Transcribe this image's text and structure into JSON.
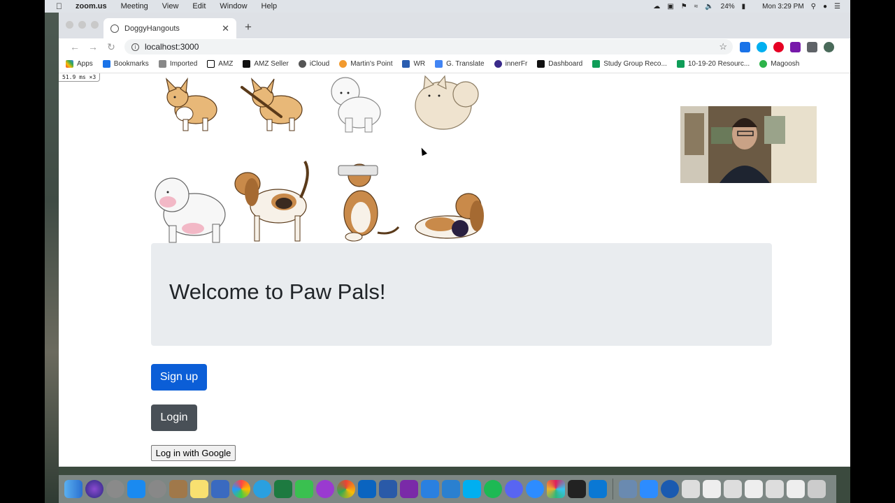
{
  "menubar": {
    "app_name": "zoom.us",
    "items": [
      "Meeting",
      "View",
      "Edit",
      "Window",
      "Help"
    ],
    "battery": "24%",
    "clock": "Mon 3:29 PM"
  },
  "browser": {
    "tab_title": "DoggyHangouts",
    "url": "localhost:3000",
    "bookmarks": [
      "Apps",
      "Bookmarks",
      "Imported",
      "AMZ",
      "AMZ Seller",
      "iCloud",
      "Martin's Point",
      "WR",
      "G. Translate",
      "innerFr",
      "Dashboard",
      "Study Group Reco...",
      "10-19-20 Resourc...",
      "Magoosh"
    ]
  },
  "page": {
    "perf_overlay": "51.9 ms ×3",
    "welcome_title": "Welcome to Paw Pals!",
    "signup_label": "Sign up",
    "login_label": "Login",
    "google_label": "Log in with Google"
  },
  "colors": {
    "primary": "#0b5ed7",
    "secondary": "#495057",
    "jumbotron": "#e9ecef"
  },
  "icons": {
    "dogs": [
      "corgi",
      "corgi-with-stick",
      "bichon",
      "pomeranian",
      "bulldog",
      "beagle",
      "beagle-with-newspaper",
      "beagle-lying"
    ]
  }
}
